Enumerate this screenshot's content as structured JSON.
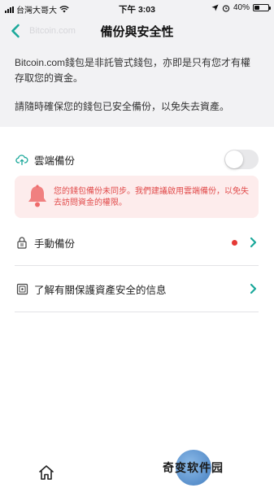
{
  "status_bar": {
    "carrier": "台灣大哥大",
    "time": "下午 3:03",
    "battery": "40%",
    "battery_level": 0.4
  },
  "header": {
    "title": "備份與安全性",
    "ghost_text": "Bitcoin.com"
  },
  "intro": {
    "paragraph_1": "Bitcoin.com錢包是非託管式錢包，亦即是只有您才有權存取您的資金。",
    "paragraph_2": "請隨時確保您的錢包已安全備份，以免失去資產。"
  },
  "cloud_backup": {
    "label": "雲端備份",
    "enabled": false
  },
  "alert": {
    "text": "您的錢包備份未同步。我們建議啟用雲端備份，以免失去訪問資金的權限。"
  },
  "manual_backup": {
    "label": "手動備份",
    "has_warning": true
  },
  "learn_more": {
    "label": "了解有關保護資產安全的信息"
  },
  "watermark": {
    "text": "奇变软件园"
  },
  "colors": {
    "accent": "#1aa89a",
    "alert_bg": "#fdecec",
    "alert_text": "#e14b4b",
    "warning_dot": "#e53935"
  },
  "icons": {
    "back": "chevron-left-icon",
    "cloud": "cloud-upload-icon",
    "bell": "bell-icon",
    "lock": "lock-icon",
    "safe": "safe-icon",
    "chevron": "chevron-right-icon",
    "home": "home-icon"
  }
}
